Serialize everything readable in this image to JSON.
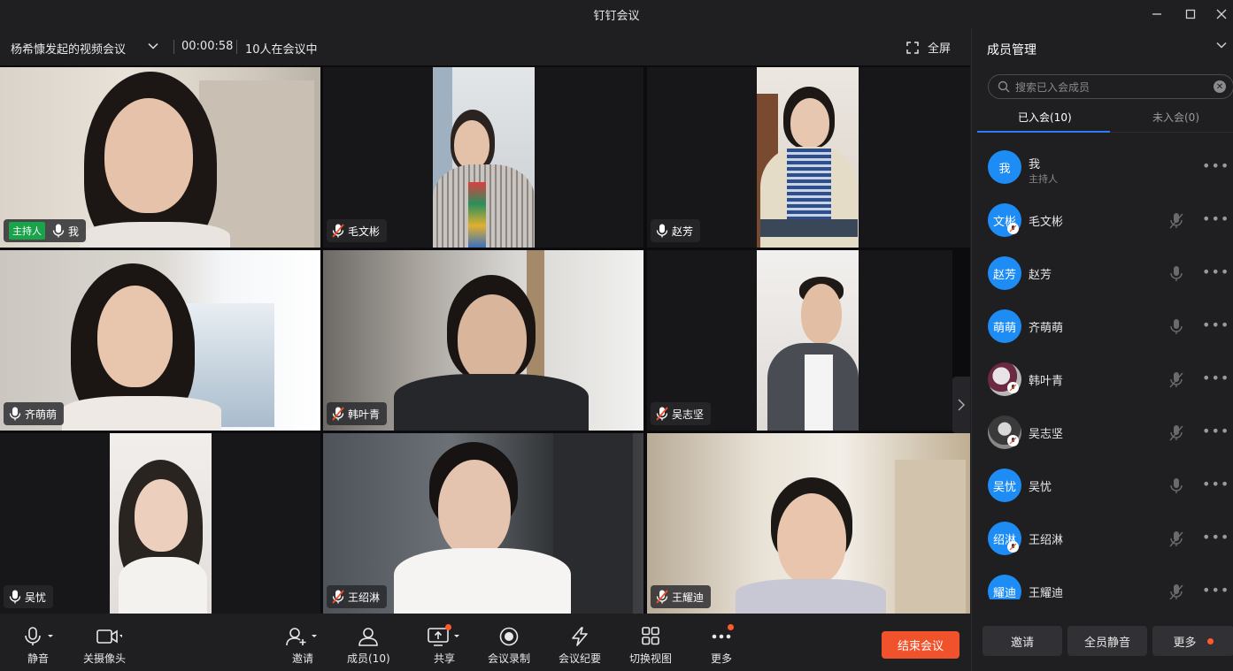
{
  "window": {
    "title": "钉钉会议",
    "controls": [
      "minimize",
      "maximize",
      "close"
    ]
  },
  "infobar": {
    "meeting_title": "杨希慷发起的视频会议",
    "duration": "00:00:58",
    "participant_count": "10人在会议中",
    "fullscreen_label": "全屏"
  },
  "tiles": [
    {
      "name": "我",
      "host_label": "主持人",
      "mic": "on"
    },
    {
      "name": "毛文彬",
      "mic": "muted"
    },
    {
      "name": "赵芳",
      "mic": "on"
    },
    {
      "name": "齐萌萌",
      "mic": "on"
    },
    {
      "name": "韩叶青",
      "mic": "muted"
    },
    {
      "name": "吴志坚",
      "mic": "muted"
    },
    {
      "name": "吴忧",
      "mic": "on"
    },
    {
      "name": "王绍淋",
      "mic": "muted"
    },
    {
      "name": "王耀迪",
      "mic": "muted"
    }
  ],
  "toolbar": {
    "mute": "静音",
    "camera_off": "关摄像头",
    "invite": "邀请",
    "members": "成员(10)",
    "share": "共享",
    "record": "会议录制",
    "minutes": "会议纪要",
    "switch_view": "切换视图",
    "more": "更多",
    "end_meeting": "结束会议"
  },
  "panel": {
    "title": "成员管理",
    "search_placeholder": "搜索已入会成员",
    "tab_joined": "已入会(10)",
    "tab_not_joined": "未入会(0)",
    "members": [
      {
        "avatar": "我",
        "name": "我",
        "role": "主持人",
        "mic": "none"
      },
      {
        "avatar": "文彬",
        "name": "毛文彬",
        "mic": "muted"
      },
      {
        "avatar": "赵芳",
        "name": "赵芳",
        "mic": "on"
      },
      {
        "avatar": "萌萌",
        "name": "齐萌萌",
        "mic": "on"
      },
      {
        "avatar": "",
        "name": "韩叶青",
        "mic": "muted"
      },
      {
        "avatar": "",
        "name": "吴志坚",
        "mic": "muted"
      },
      {
        "avatar": "吴忧",
        "name": "吴忧",
        "mic": "on"
      },
      {
        "avatar": "绍淋",
        "name": "王绍淋",
        "mic": "muted"
      },
      {
        "avatar": "耀迪",
        "name": "王耀迪",
        "mic": "muted"
      }
    ],
    "footer": {
      "invite": "邀请",
      "mute_all": "全员静音",
      "more": "更多"
    }
  },
  "colors": {
    "accent_blue": "#1e8cf5",
    "end_red": "#f0522b",
    "host_green": "#19a34a",
    "notify_dot": "#ff5a2a"
  }
}
